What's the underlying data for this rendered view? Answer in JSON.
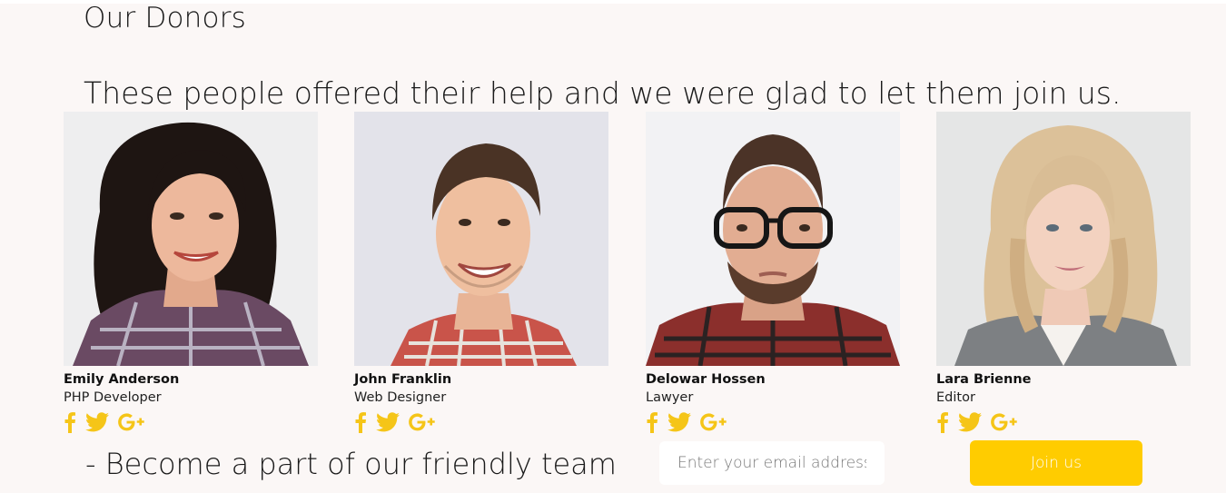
{
  "section": {
    "title": "Our Donors",
    "subtitle": "These people offered their help and we were glad to let them join us."
  },
  "donors": [
    {
      "name": "Emily Anderson",
      "role": "PHP Developer",
      "photo": "woman-dark-curly-hair-plaid-shirt-photo"
    },
    {
      "name": "John Franklin",
      "role": "Web Designer",
      "photo": "smiling-man-plaid-shirt-photo"
    },
    {
      "name": "Delowar Hossen",
      "role": "Lawyer",
      "photo": "bearded-man-glasses-photo"
    },
    {
      "name": "Lara Brienne",
      "role": "Editor",
      "photo": "blonde-woman-blazer-photo"
    }
  ],
  "social_icons": [
    "facebook-icon",
    "twitter-icon",
    "google-plus-icon"
  ],
  "cta": {
    "text": "- Become a part of our friendly team",
    "email_placeholder": "Enter your email address*",
    "email_value": "",
    "button_label": "Join us"
  },
  "colors": {
    "accent": "#ffcc00",
    "background": "#fbf7f6",
    "text": "#1a1a1a"
  }
}
